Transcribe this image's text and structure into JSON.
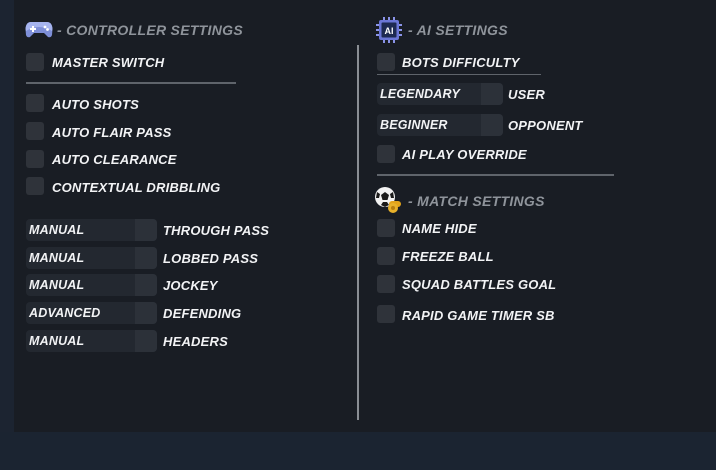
{
  "controller": {
    "title": "- CONTROLLER SETTINGS",
    "icon": "gamepad-icon",
    "master_switch": "MASTER SWITCH",
    "toggles": [
      "AUTO SHOTS",
      "AUTO FLAIR PASS",
      "AUTO CLEARANCE",
      "CONTEXTUAL DRIBBLING"
    ],
    "selects": [
      {
        "value": "MANUAL",
        "label": "THROUGH PASS"
      },
      {
        "value": "MANUAL",
        "label": "LOBBED PASS"
      },
      {
        "value": "MANUAL",
        "label": "JOCKEY"
      },
      {
        "value": "ADVANCED",
        "label": "DEFENDING"
      },
      {
        "value": "MANUAL",
        "label": "HEADERS"
      }
    ]
  },
  "ai": {
    "title": "- AI SETTINGS",
    "icon": "ai-chip-icon",
    "icon_text": "AI",
    "bots_difficulty": "BOTS DIFFICULTY",
    "selects": [
      {
        "value": "LEGENDARY",
        "label": "USER"
      },
      {
        "value": "BEGINNER",
        "label": "OPPONENT"
      }
    ],
    "play_override": "AI PLAY OVERRIDE"
  },
  "match": {
    "title": "- MATCH SETTINGS",
    "icon": "soccer-ball-whistle-icon",
    "toggles": [
      "NAME HIDE",
      "FREEZE BALL",
      "SQUAD BATTLES GOAL",
      "RAPID GAME TIMER SB"
    ]
  },
  "colors": {
    "panel": "#191d24",
    "checkbox": "#2f333a",
    "text": "#f2f3f5",
    "section_title": "#8f949b"
  }
}
